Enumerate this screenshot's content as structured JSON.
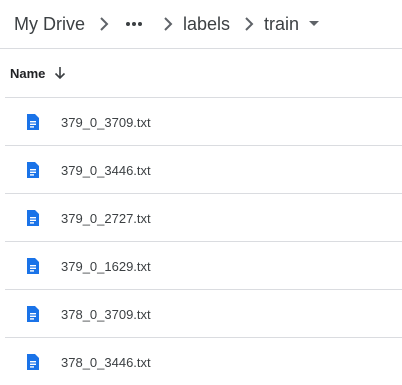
{
  "breadcrumb": {
    "root": "My Drive",
    "more": "more-icon",
    "folder": "labels",
    "current": "train"
  },
  "header": {
    "name_label": "Name",
    "sort": "arrow-down-icon"
  },
  "files": [
    {
      "name": "379_0_3709.txt",
      "icon": "document-icon"
    },
    {
      "name": "379_0_3446.txt",
      "icon": "document-icon"
    },
    {
      "name": "379_0_2727.txt",
      "icon": "document-icon"
    },
    {
      "name": "379_0_1629.txt",
      "icon": "document-icon"
    },
    {
      "name": "378_0_3709.txt",
      "icon": "document-icon"
    },
    {
      "name": "378_0_3446.txt",
      "icon": "document-icon"
    }
  ],
  "colors": {
    "doc_blue": "#1a73e8",
    "divider": "#dadce0",
    "text": "#3c4043"
  }
}
